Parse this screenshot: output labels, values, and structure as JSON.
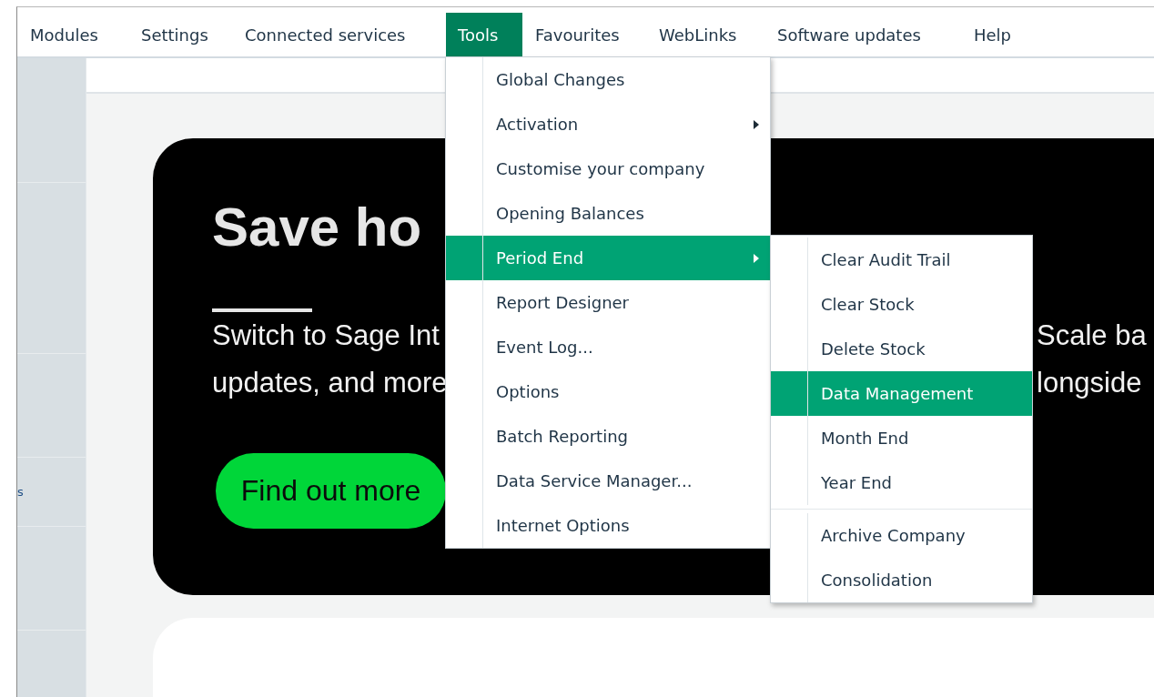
{
  "menubar": [
    {
      "label": "Modules",
      "selected": false
    },
    {
      "label": "Settings",
      "selected": false
    },
    {
      "label": "Connected services",
      "selected": false
    },
    {
      "label": "Tools",
      "selected": true
    },
    {
      "label": "Favourites",
      "selected": false
    },
    {
      "label": "WebLinks",
      "selected": false
    },
    {
      "label": "Software updates",
      "selected": false
    },
    {
      "label": "Help",
      "selected": false
    }
  ],
  "sidebar": {
    "text": "s"
  },
  "banner": {
    "headline_left": "Save ho",
    "lines": [
      {
        "left": "Switch to Sage Int",
        "right": "Scale ba"
      },
      {
        "left": "updates, and more",
        "right": "longside"
      }
    ],
    "button": "Find out more"
  },
  "tools_menu": {
    "items": [
      {
        "label": "Global Changes",
        "has_submenu": false,
        "selected": false
      },
      {
        "label": "Activation",
        "has_submenu": true,
        "selected": false
      },
      {
        "label": "Customise your company",
        "has_submenu": false,
        "selected": false
      },
      {
        "label": "Opening Balances",
        "has_submenu": false,
        "selected": false
      },
      {
        "label": "Period End",
        "has_submenu": true,
        "selected": true
      },
      {
        "label": "Report Designer",
        "has_submenu": false,
        "selected": false
      },
      {
        "label": "Event Log...",
        "has_submenu": false,
        "selected": false
      },
      {
        "label": "Options",
        "has_submenu": false,
        "selected": false
      },
      {
        "label": "Batch Reporting",
        "has_submenu": false,
        "selected": false
      },
      {
        "label": "Data Service Manager...",
        "has_submenu": false,
        "selected": false
      },
      {
        "label": "Internet Options",
        "has_submenu": false,
        "selected": false
      }
    ]
  },
  "period_end_submenu": {
    "groups": [
      [
        {
          "label": "Clear Audit Trail",
          "selected": false
        },
        {
          "label": "Clear Stock",
          "selected": false
        },
        {
          "label": "Delete Stock",
          "selected": false
        },
        {
          "label": "Data Management",
          "selected": true
        },
        {
          "label": "Month End",
          "selected": false
        },
        {
          "label": "Year End",
          "selected": false
        }
      ],
      [
        {
          "label": "Archive Company",
          "selected": false
        },
        {
          "label": "Consolidation",
          "selected": false
        }
      ]
    ]
  }
}
